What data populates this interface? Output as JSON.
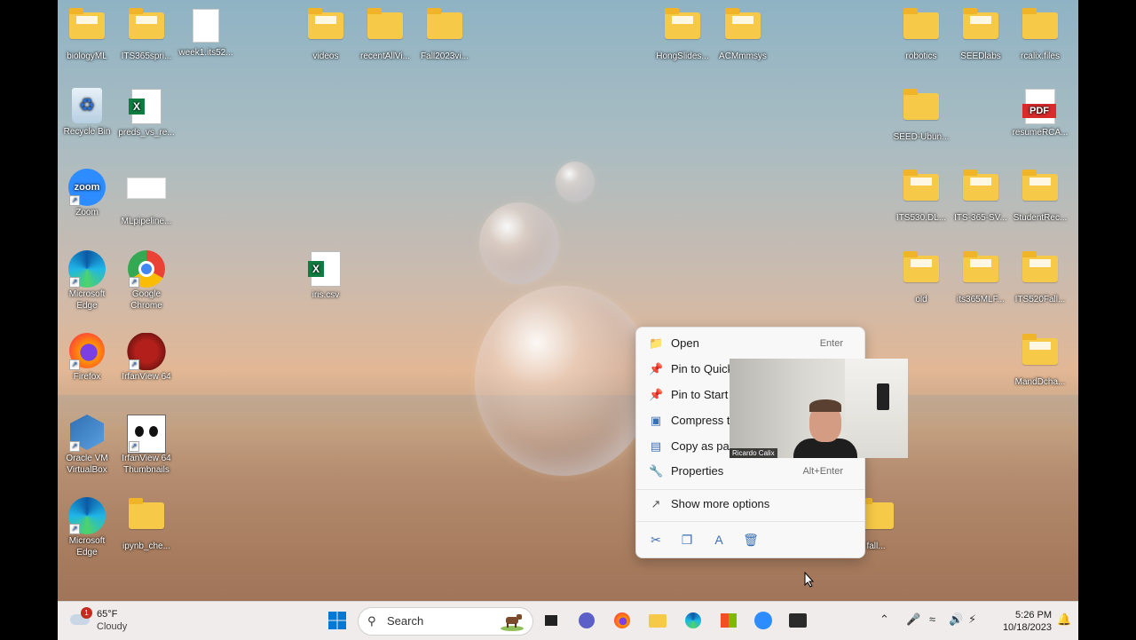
{
  "desktop_icons": {
    "biologyml": "biologyML",
    "its365spri": "ITS365spri...",
    "week1": "week1.its52...",
    "videos": "videos",
    "recentallvi": "recentAllVi...",
    "fall2023vi": "Fall2023vi...",
    "hongslides": "HongSlides...",
    "acmmmsys": "ACMmmsys",
    "robotics": "robotics",
    "seedlabs": "SEEDlabs",
    "rcalixfiles": "rcalix.files",
    "recycle_bin": "Recycle Bin",
    "preds_vs_re": "preds_vs_re...",
    "seed_ubun": "SEED-Ubun...",
    "resumercal": "resumeRCA...",
    "zoom": "Zoom",
    "mlpipeline": "MLpipeline...",
    "its530dl": "ITS530.DL...",
    "its365sv": "ITS-365-SV...",
    "studentrec": "StudentRec...",
    "edge1_a": "Microsoft",
    "edge1_b": "Edge",
    "chrome_a": "Google",
    "chrome_b": "Chrome",
    "iris": "iris.csv",
    "old": "old",
    "its365mlf": "its365MLF...",
    "its520fall": "ITS520Fall...",
    "firefox": "Firefox",
    "irfanview": "IrfanView 64",
    "mandcha": "MandDcha...",
    "oracle_a": "Oracle VM",
    "oracle_b": "VirtualBox",
    "irfanthumb_a": "IrfanView 64",
    "irfanthumb_b": "Thumbnails",
    "edge2_a": "Microsoft",
    "edge2_b": "Edge",
    "ipynb": "ipynb_che...",
    "fall_partial": "fall..."
  },
  "context_menu": {
    "open": "Open",
    "open_shortcut": "Enter",
    "pin_quick": "Pin to Quick",
    "pin_start": "Pin to Start",
    "compress": "Compress to",
    "copy_path": "Copy as pat",
    "properties": "Properties",
    "properties_shortcut": "Alt+Enter",
    "more_options": "Show more options"
  },
  "webcam": {
    "name": "Ricardo Calix"
  },
  "taskbar": {
    "weather_temp": "65°F",
    "weather_desc": "Cloudy",
    "weather_badge": "1",
    "search_placeholder": "Search",
    "time": "5:26 PM",
    "date": "10/18/2023"
  },
  "colors": {
    "folder": "#f7c948",
    "accent": "#0067c0",
    "taskbar": "#efeceb"
  }
}
